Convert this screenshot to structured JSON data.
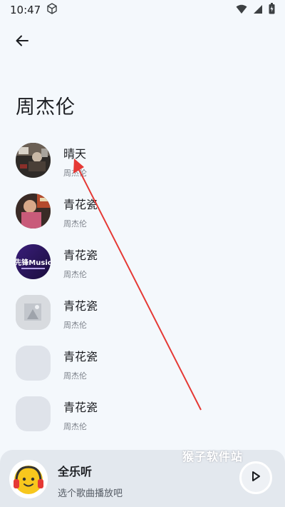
{
  "status": {
    "time": "10:47"
  },
  "header": {
    "title": "周杰伦"
  },
  "songs": [
    {
      "title": "晴天",
      "artist": "周杰伦"
    },
    {
      "title": "青花瓷",
      "artist": "周杰伦"
    },
    {
      "title": "青花瓷",
      "artist": "周杰伦"
    },
    {
      "title": "青花瓷",
      "artist": "周杰伦"
    },
    {
      "title": "青花瓷",
      "artist": "周杰伦"
    },
    {
      "title": "青花瓷",
      "artist": "周杰伦"
    }
  ],
  "cover3_text": "先锋Music",
  "player": {
    "title": "全乐听",
    "subtitle": "选个歌曲播放吧"
  },
  "watermark": "猴子软件站",
  "colors": {
    "accent_arrow": "#e53935",
    "player_bg": "#e3e8ee",
    "page_bg": "#f4f8fc"
  }
}
